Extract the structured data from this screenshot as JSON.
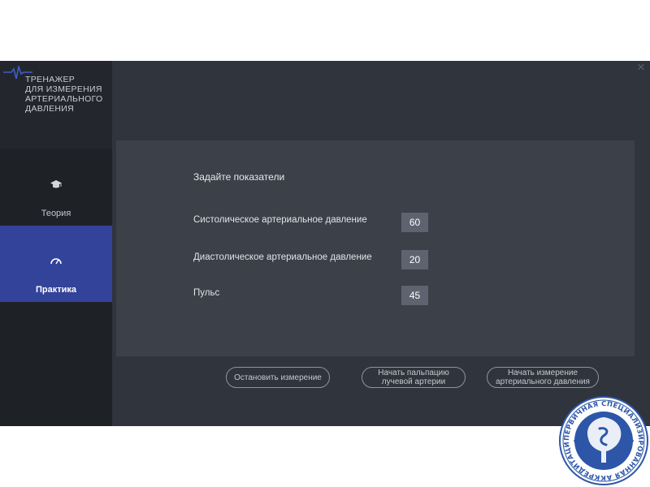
{
  "app": {
    "logo_lines": [
      "ТРЕНАЖЕР",
      "ДЛЯ ИЗМЕРЕНИЯ",
      "АРТЕРИАЛЬНОГО",
      "ДАВЛЕНИЯ"
    ],
    "close_icon": "close-icon"
  },
  "sidebar": {
    "items": [
      {
        "label": "Теория",
        "icon": "graduation-cap-icon",
        "active": false
      },
      {
        "label": "Практика",
        "icon": "gauge-icon",
        "active": true
      }
    ]
  },
  "panel": {
    "title": "Задайте показатели",
    "params": [
      {
        "label": "Систолическое артериальное давление",
        "value": "60"
      },
      {
        "label": "Диастолическое артериальное давление",
        "value": "20"
      },
      {
        "label": "Пульс",
        "value": "45"
      }
    ]
  },
  "buttons": {
    "stop": "Остановить измерение",
    "palpation_line1": "Начать пальпацию",
    "palpation_line2": "лучевой артерии",
    "measure_line1": "Начать измерение",
    "measure_line2": "артериального давления"
  },
  "seal": {
    "text": "ПЕРВИЧНАЯ СПЕЦИАЛИЗИРОВАННАЯ АККРЕДИТАЦИЯ"
  },
  "colors": {
    "accent": "#33439a",
    "background": "#2f343d",
    "sidebar": "#1e2227",
    "panel": "#3b4049",
    "value_box": "#5d6470",
    "seal_blue": "#2d56a8"
  }
}
